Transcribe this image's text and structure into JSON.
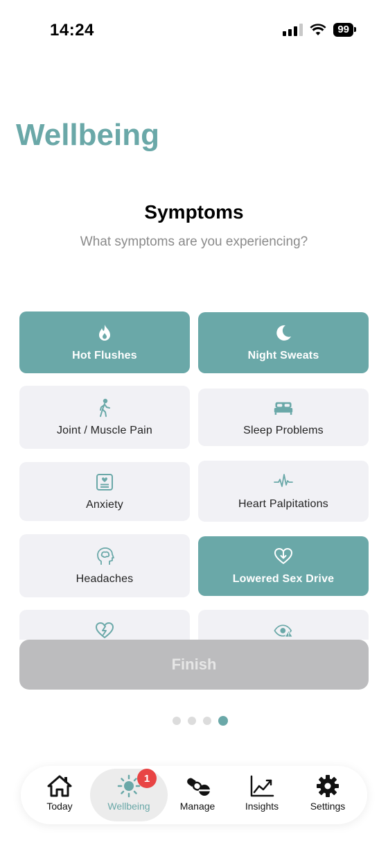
{
  "status_bar": {
    "time": "14:24",
    "battery": "99"
  },
  "header": {
    "title": "Wellbeing"
  },
  "section": {
    "title": "Symptoms",
    "subtitle": "What symptoms are you experiencing?"
  },
  "symptoms": [
    {
      "label": "Hot Flushes",
      "icon": "flame-icon",
      "selected": true
    },
    {
      "label": "Night Sweats",
      "icon": "moon-icon",
      "selected": true
    },
    {
      "label": "Joint / Muscle Pain",
      "icon": "walking-person-icon",
      "selected": false
    },
    {
      "label": "Sleep Problems",
      "icon": "bed-icon",
      "selected": false
    },
    {
      "label": "Anxiety",
      "icon": "anxiety-frame-icon",
      "selected": false
    },
    {
      "label": "Heart Palpitations",
      "icon": "heartbeat-icon",
      "selected": false
    },
    {
      "label": "Headaches",
      "icon": "head-brain-icon",
      "selected": false
    },
    {
      "label": "Lowered Sex Drive",
      "icon": "heart-down-icon",
      "selected": true
    },
    {
      "label": "",
      "icon": "broken-heart-icon",
      "selected": false
    },
    {
      "label": "",
      "icon": "eye-warning-icon",
      "selected": false
    }
  ],
  "finish_button": {
    "label": "Finish"
  },
  "pagination": {
    "total": 4,
    "current": 4
  },
  "tab_bar": {
    "tabs": [
      {
        "label": "Today",
        "icon": "home-icon"
      },
      {
        "label": "Wellbeing",
        "icon": "sun-icon",
        "badge": "1",
        "active": true
      },
      {
        "label": "Manage",
        "icon": "pills-icon"
      },
      {
        "label": "Insights",
        "icon": "chart-icon"
      },
      {
        "label": "Settings",
        "icon": "gear-icon"
      }
    ]
  },
  "colors": {
    "accent": "#6aa8a8",
    "card_bg": "#f1f1f5",
    "finish_bg": "#bcbcbe",
    "badge": "#e84444"
  }
}
